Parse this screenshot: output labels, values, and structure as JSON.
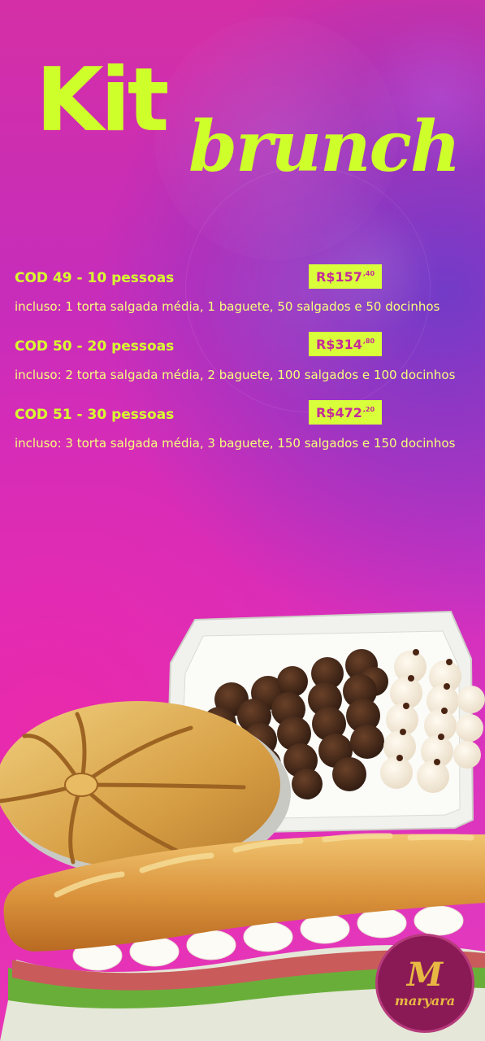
{
  "title": {
    "kit": "Kit",
    "brunch": "brunch"
  },
  "offers": [
    {
      "name": "COD 49 - 10 pessoas",
      "price_main": "R$157",
      "price_cents": ",40",
      "description": "incluso: 1 torta salgada média, 1 baguete, 50 salgados e 50 docinhos"
    },
    {
      "name": "COD 50 - 20 pessoas",
      "price_main": "R$314",
      "price_cents": ",80",
      "description": "incluso: 2 torta salgada média, 2 baguete, 100 salgados e 100 docinhos"
    },
    {
      "name": "COD 51 - 30 pessoas",
      "price_main": "R$472",
      "price_cents": ",20",
      "description": "incluso: 3 torta salgada média, 3 baguete, 150 salgados e 150 docinhos"
    }
  ],
  "brand": {
    "mark": "M",
    "name": "maryara"
  },
  "colors": {
    "accent": "#cfff2a",
    "price_text": "#c52b9a",
    "logo_bg": "#8a1a55",
    "logo_gold": "#e8b843"
  }
}
